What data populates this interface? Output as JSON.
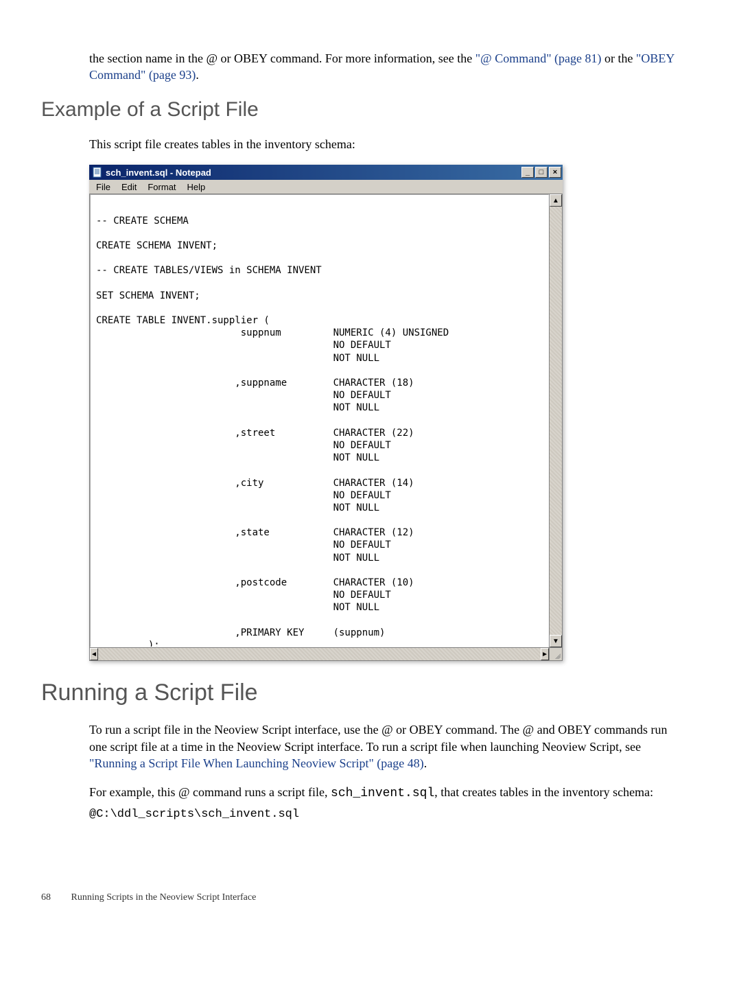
{
  "intro": {
    "text_before_link1": "the section name in the @ or OBEY command. For more information, see the",
    "link1": "\"@ Command\" (page 81)",
    "text_mid": " or the ",
    "link2": "\"OBEY Command\" (page 93)",
    "trail": "."
  },
  "section1": {
    "heading": "Example of a Script File",
    "para": "This script file creates tables in the inventory schema:"
  },
  "notepad": {
    "title": "sch_invent.sql - Notepad",
    "menu": [
      "File",
      "Edit",
      "Format",
      "Help"
    ],
    "content": "\n-- CREATE SCHEMA\n\nCREATE SCHEMA INVENT;\n\n-- CREATE TABLES/VIEWS in SCHEMA INVENT\n\nSET SCHEMA INVENT;\n\nCREATE TABLE INVENT.supplier (\n                         suppnum         NUMERIC (4) UNSIGNED\n                                         NO DEFAULT\n                                         NOT NULL\n\n                        ,suppname        CHARACTER (18)\n                                         NO DEFAULT\n                                         NOT NULL\n\n                        ,street          CHARACTER (22)\n                                         NO DEFAULT\n                                         NOT NULL\n\n                        ,city            CHARACTER (14)\n                                         NO DEFAULT\n                                         NOT NULL\n\n                        ,state           CHARACTER (12)\n                                         NO DEFAULT\n                                         NOT NULL\n\n                        ,postcode        CHARACTER (10)\n                                         NO DEFAULT\n                                         NOT NULL\n\n                        ,PRIMARY KEY     (suppnum)\n         );",
    "scroll_up": "▲",
    "scroll_down": "▼",
    "scroll_left": "◄",
    "scroll_right": "►"
  },
  "section2": {
    "heading": "Running a Script File",
    "para1_a": "To run a script file in the Neoview Script interface, use the @ or OBEY command. The @ and OBEY commands run one script file at a time in the Neoview Script interface. To run a script file when launching Neoview Script, see ",
    "para1_link": "\"Running a Script File When Launching Neoview Script\" (page 48)",
    "para1_b": ".",
    "para2_a": "For example, this @ command runs a script file, ",
    "para2_code": "sch_invent.sql",
    "para2_b": ", that creates tables in the inventory schema:",
    "command": "@C:\\ddl_scripts\\sch_invent.sql"
  },
  "footer": {
    "page": "68",
    "title": "Running Scripts in the Neoview Script Interface"
  }
}
